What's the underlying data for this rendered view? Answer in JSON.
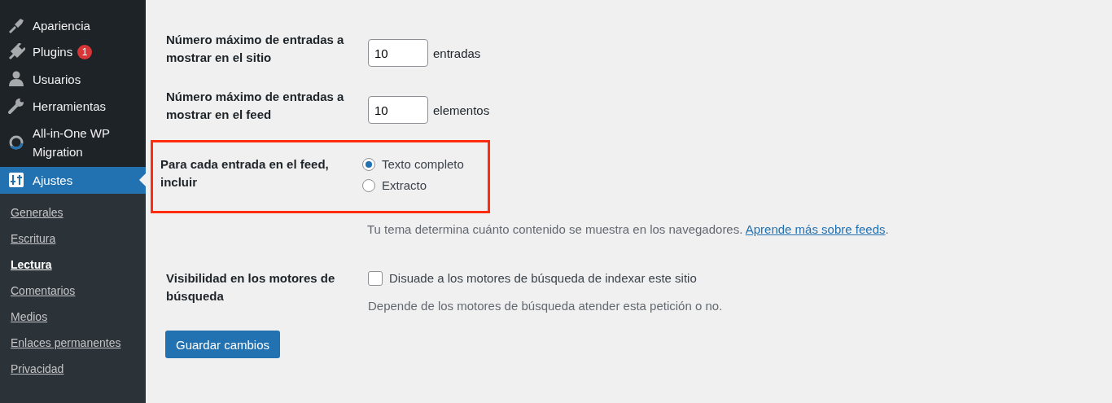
{
  "sidebar": {
    "items": [
      {
        "label": "Apariencia",
        "selected": false
      },
      {
        "label": "Plugins",
        "selected": false,
        "badge": "1"
      },
      {
        "label": "Usuarios",
        "selected": false
      },
      {
        "label": "Herramientas",
        "selected": false
      },
      {
        "label": "All-in-One WP Migration",
        "selected": false
      },
      {
        "label": "Ajustes",
        "selected": true
      }
    ],
    "submenu": [
      {
        "label": "Generales",
        "selected": false
      },
      {
        "label": "Escritura",
        "selected": false
      },
      {
        "label": "Lectura",
        "selected": true
      },
      {
        "label": "Comentarios",
        "selected": false
      },
      {
        "label": "Medios",
        "selected": false
      },
      {
        "label": "Enlaces permanentes",
        "selected": false
      },
      {
        "label": "Privacidad",
        "selected": false
      }
    ]
  },
  "settings": [
    {
      "kind": "number",
      "label": "Número máximo de entradas a mostrar en el sitio",
      "value": "10",
      "unit": "entradas",
      "highlighted": false
    },
    {
      "kind": "number",
      "label": "Número máximo de entradas a mostrar en el feed",
      "value": "10",
      "unit": "elementos",
      "highlighted": false
    },
    {
      "kind": "radio",
      "label": "Para cada entrada en el feed, incluir",
      "highlighted": true,
      "options": [
        {
          "label": "Texto completo",
          "selected": true
        },
        {
          "label": "Extracto",
          "selected": false
        }
      ],
      "description": "Tu tema determina cuánto contenido se muestra en los navegadores.",
      "link": "Aprende más sobre feeds",
      "link_suffix": "."
    },
    {
      "kind": "checkbox",
      "label": "Visibilidad en los motores de búsqueda",
      "checkbox_label": "Disuade a los motores de búsqueda de indexar este sitio",
      "checked": false,
      "highlighted": false,
      "description": "Depende de los motores de búsqueda atender esta petición o no."
    }
  ],
  "save_button": "Guardar cambios"
}
